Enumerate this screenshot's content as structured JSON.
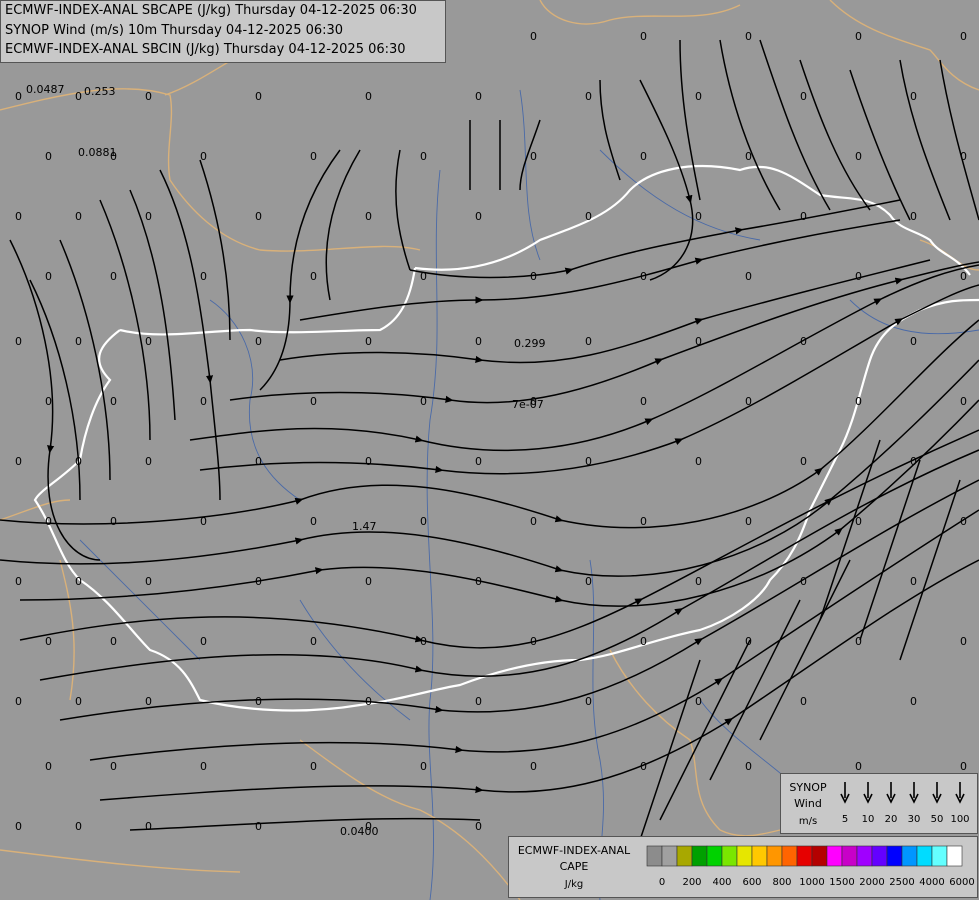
{
  "header": {
    "line1": "ECMWF-INDEX-ANAL SBCAPE (J/kg) Thursday 04-12-2025 06:30",
    "line2": "SYNOP Wind (m/s) 10m Thursday 04-12-2025 06:30",
    "line3": "ECMWF-INDEX-ANAL SBCIN (J/kg) Thursday 04-12-2025 06:30"
  },
  "labels": {
    "special": [
      "0.0487",
      "0.253",
      "0.0881",
      "0.299",
      "7e-07",
      "1.47",
      "0.0400"
    ],
    "zero": "0"
  },
  "wind_legend": {
    "title1": "SYNOP",
    "title2": "Wind",
    "unit": "m/s",
    "speeds": [
      "5",
      "10",
      "20",
      "30",
      "50",
      "100"
    ]
  },
  "cape_legend": {
    "title1": "ECMWF-INDEX-ANAL",
    "title2": "CAPE",
    "unit": "J/kg",
    "ticks": [
      "0",
      "200",
      "400",
      "600",
      "800",
      "1000",
      "1500",
      "2000",
      "2500",
      "4000",
      "6000"
    ],
    "colors": [
      "#8c8c8c",
      "#a0a0a0",
      "#a8a800",
      "#00a000",
      "#00d200",
      "#7ae600",
      "#e6e600",
      "#ffc800",
      "#ff9600",
      "#ff6400",
      "#e60000",
      "#b40000",
      "#ff00ff",
      "#c800c8",
      "#a000ff",
      "#6400ff",
      "#0000ff",
      "#0096ff",
      "#00dcff",
      "#64ffff",
      "#ffffff"
    ]
  },
  "colors": {
    "background": "#999999",
    "border_main": "#ffffff",
    "border_other": "#d9b17a",
    "rivers": "#4a6aa8",
    "streamlines": "#000000"
  }
}
